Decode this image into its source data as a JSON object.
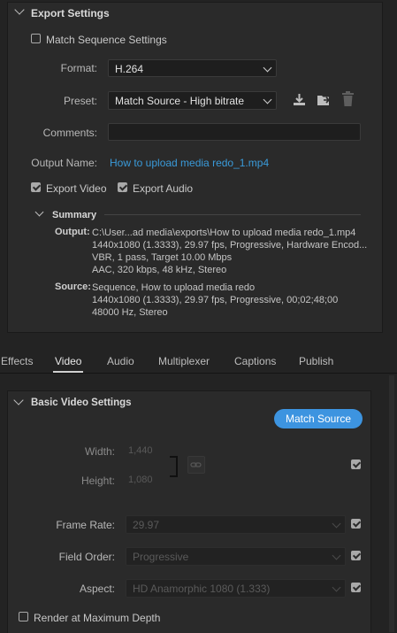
{
  "export_settings": {
    "header": "Export Settings",
    "match_sequence": "Match Sequence Settings",
    "format_label": "Format:",
    "format_value": "H.264",
    "preset_label": "Preset:",
    "preset_value": "Match Source - High bitrate",
    "comments_label": "Comments:",
    "comments_value": "",
    "output_name_label": "Output Name:",
    "output_name_value": "How to upload media redo_1.mp4",
    "export_video": "Export Video",
    "export_audio": "Export Audio"
  },
  "summary": {
    "header": "Summary",
    "output_label": "Output:",
    "output_lines": [
      "C:\\User...ad media\\exports\\How to upload media redo_1.mp4",
      "1440x1080 (1.3333), 29.97 fps, Progressive, Hardware Encod...",
      "VBR, 1 pass, Target 10.00 Mbps",
      "AAC, 320 kbps, 48 kHz, Stereo"
    ],
    "source_label": "Source:",
    "source_lines": [
      "Sequence, How to upload media redo",
      "1440x1080 (1.3333), 29.97 fps, Progressive, 00;02;48;00",
      "48000 Hz, Stereo"
    ]
  },
  "tabs": {
    "items": [
      "Effects",
      "Video",
      "Audio",
      "Multiplexer",
      "Captions",
      "Publish"
    ],
    "active": "Video"
  },
  "video": {
    "header": "Basic Video Settings",
    "match_source_btn": "Match Source",
    "width_label": "Width:",
    "width_value": "1,440",
    "height_label": "Height:",
    "height_value": "1,080",
    "frame_rate_label": "Frame Rate:",
    "frame_rate_value": "29.97",
    "field_order_label": "Field Order:",
    "field_order_value": "Progressive",
    "aspect_label": "Aspect:",
    "aspect_value": "HD Anamorphic 1080 (1.333)",
    "render_max_depth": "Render at Maximum Depth"
  },
  "colors": {
    "accent_blue": "#3d94e0",
    "link_blue": "#3a9ad9",
    "panel_bg": "#232323"
  }
}
